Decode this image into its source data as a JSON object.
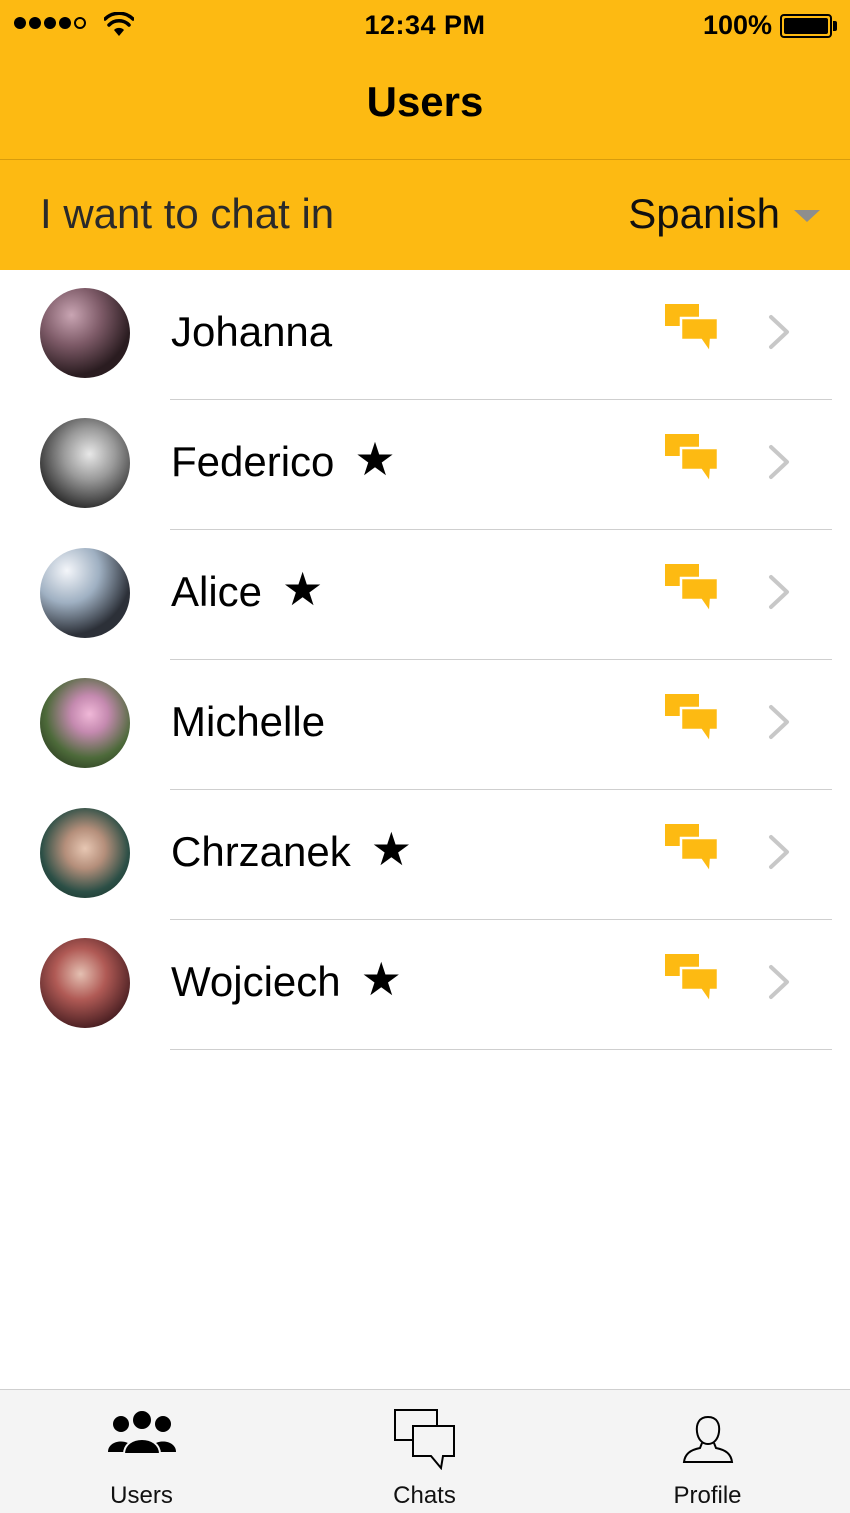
{
  "status_bar": {
    "time": "12:34 PM",
    "battery": "100%"
  },
  "nav": {
    "title": "Users"
  },
  "language": {
    "label": "I want to chat in",
    "selected": "Spanish"
  },
  "users": [
    {
      "name": "Johanna",
      "starred": false
    },
    {
      "name": "Federico",
      "starred": true
    },
    {
      "name": "Alice",
      "starred": true
    },
    {
      "name": "Michelle",
      "starred": false
    },
    {
      "name": "Chrzanek",
      "starred": true
    },
    {
      "name": "Wojciech",
      "starred": true
    }
  ],
  "star_glyph": "★",
  "tabs": [
    {
      "label": "Users",
      "icon": "users-icon",
      "active": true
    },
    {
      "label": "Chats",
      "icon": "chats-icon",
      "active": false
    },
    {
      "label": "Profile",
      "icon": "profile-icon",
      "active": false
    }
  ],
  "colors": {
    "accent": "#fdba12",
    "chevron": "#c8c8c8",
    "divider": "#cfcfcf",
    "tab_bar": "#f4f4f4"
  }
}
